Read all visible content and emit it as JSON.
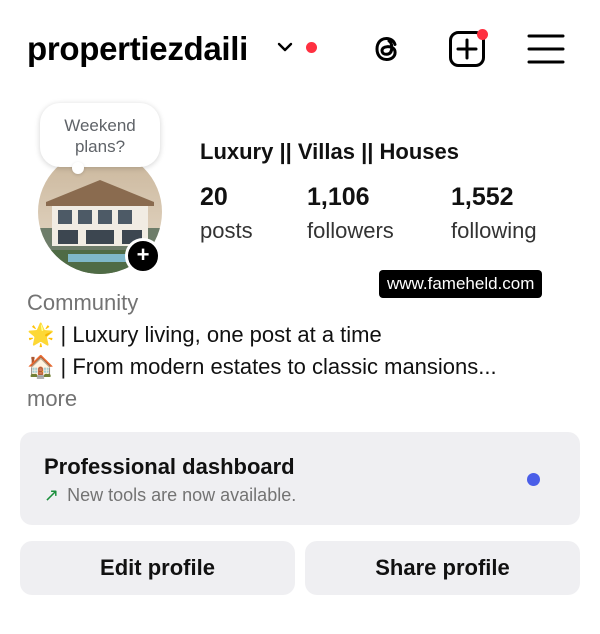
{
  "header": {
    "username": "propertiezdaili",
    "icons": [
      "chevron-down-icon",
      "threads-icon",
      "new-post-icon",
      "menu-icon"
    ],
    "notification_color": "#ff3040"
  },
  "profile": {
    "note": "Weekend plans?",
    "name": "Luxury || Villas || Houses",
    "stats": [
      {
        "value": "20",
        "label": "posts"
      },
      {
        "value": "1,106",
        "label": "followers"
      },
      {
        "value": "1,552",
        "label": "following"
      }
    ],
    "watermark": "www.fameheld.com",
    "category": "Community",
    "bio": [
      {
        "emoji": "🌟",
        "text": " | Luxury living, one post at a time"
      },
      {
        "emoji": "🏠",
        "text": " | From modern estates to classic mansions..."
      }
    ],
    "more": "more"
  },
  "dashboard": {
    "title": "Professional dashboard",
    "subtitle": "New tools are now available.",
    "arrow": "↗",
    "dot_color": "#4a5ee8"
  },
  "buttons": {
    "edit": "Edit profile",
    "share": "Share profile"
  }
}
